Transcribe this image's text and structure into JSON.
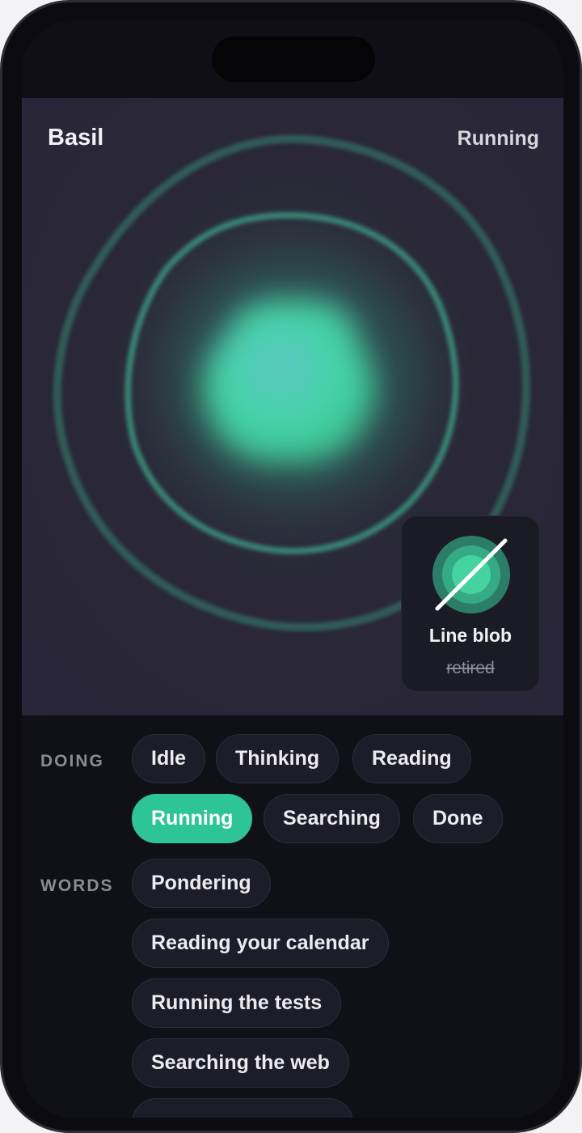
{
  "header": {
    "agent_name": "Basil",
    "state_label": "Running"
  },
  "style_card": {
    "title": "Line blob",
    "status": "retired",
    "icon": "line-blob-icon"
  },
  "doing": {
    "label": "DOING",
    "options": [
      "Idle",
      "Thinking",
      "Reading",
      "Running",
      "Searching",
      "Done"
    ],
    "selected": "Running"
  },
  "words": {
    "label": "WORDS",
    "options": [
      "Pondering",
      "Reading your calendar",
      "Running the tests",
      "Searching the web"
    ]
  },
  "colors": {
    "accent": "#2ec596",
    "ring": "#3a8f7d",
    "background": "#282538",
    "controls_background": "#101017"
  }
}
